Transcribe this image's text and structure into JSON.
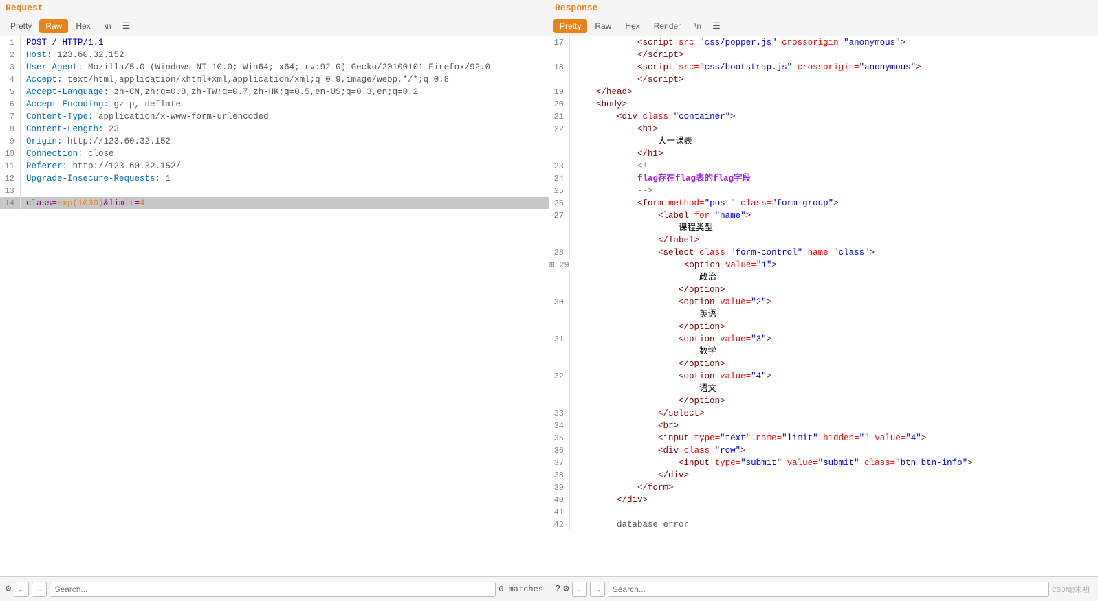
{
  "request": {
    "header": "Request",
    "tabs": [
      "Pretty",
      "Raw",
      "Hex",
      "\\n",
      "☰"
    ],
    "active_tab": "Raw",
    "lines": [
      {
        "num": 1,
        "content": "POST / HTTP/1.1",
        "type": "method"
      },
      {
        "num": 2,
        "content": "Host: 123.60.32.152",
        "type": "header"
      },
      {
        "num": 3,
        "content": "User-Agent: Mozilla/5.0 (Windows NT 10.0; Win64; x64; rv:92.0) Gecko/20100101 Firefox/92.0",
        "type": "header"
      },
      {
        "num": 4,
        "content": "Accept: text/html,application/xhtml+xml,application/xml;q=0.9,image/webp,*/*;q=0.8",
        "type": "header"
      },
      {
        "num": 5,
        "content": "Accept-Language: zh-CN,zh;q=0.8,zh-TW;q=0.7,zh-HK;q=0.5,en-US;q=0.3,en;q=0.2",
        "type": "header"
      },
      {
        "num": 6,
        "content": "Accept-Encoding: gzip, deflate",
        "type": "header"
      },
      {
        "num": 7,
        "content": "Content-Type: application/x-www-form-urlencoded",
        "type": "header"
      },
      {
        "num": 8,
        "content": "Content-Length: 23",
        "type": "header"
      },
      {
        "num": 9,
        "content": "Origin: http://123.60.32.152",
        "type": "header"
      },
      {
        "num": 10,
        "content": "Connection: close",
        "type": "header"
      },
      {
        "num": 11,
        "content": "Referer: http://123.60.32.152/",
        "type": "header"
      },
      {
        "num": 12,
        "content": "Upgrade-Insecure-Requests: 1",
        "type": "header"
      },
      {
        "num": 13,
        "content": "",
        "type": "empty"
      },
      {
        "num": 14,
        "content": "class=exp(1000)&limit=4",
        "type": "body",
        "highlighted": true
      }
    ]
  },
  "response": {
    "header": "Response",
    "tabs": [
      "Pretty",
      "Raw",
      "Hex",
      "Render",
      "\\n",
      "☰"
    ],
    "active_tab": "Pretty",
    "lines": [
      {
        "num": 17,
        "html": "<span class='res-tag'>&lt;script</span> <span class='res-attr-name'>src=</span><span class='res-attr-value'>\"css/popper.js\"</span> <span class='res-attr-name'>crossorigin=</span><span class='res-attr-value'>\"anonymous\"</span><span class='res-tag'>&gt;</span>",
        "indent": 12
      },
      {
        "num": null,
        "html": "<span class='res-tag'>&lt;/script&gt;</span>",
        "indent": 12
      },
      {
        "num": 18,
        "html": "<span class='res-tag'>&lt;script</span> <span class='res-attr-name'>src=</span><span class='res-attr-value'>\"css/bootstrap.js\"</span> <span class='res-attr-name'>crossorigin=</span><span class='res-attr-value'>\"anonymous\"</span><span class='res-tag'>&gt;</span>",
        "indent": 12
      },
      {
        "num": null,
        "html": "<span class='res-tag'>&lt;/script&gt;</span>",
        "indent": 12
      },
      {
        "num": 19,
        "html": "<span class='res-tag'>&lt;/head&gt;</span>",
        "indent": 4
      },
      {
        "num": 20,
        "html": "<span class='res-tag'>&lt;body&gt;</span>",
        "indent": 4
      },
      {
        "num": 21,
        "html": "<span class='res-tag'>&lt;div</span> <span class='res-attr-name'>class=</span><span class='res-attr-value'>\"container\"</span><span class='res-tag'>&gt;</span>",
        "indent": 8
      },
      {
        "num": 22,
        "html": "<span class='res-tag'>&lt;h1&gt;</span>",
        "indent": 12
      },
      {
        "num": null,
        "html": "<span class='res-text'>大一课表</span>",
        "indent": 16
      },
      {
        "num": null,
        "html": "<span class='res-tag'>&lt;/h1&gt;</span>",
        "indent": 12
      },
      {
        "num": 23,
        "html": "<span class='res-comment'>&lt;!--</span>",
        "indent": 12
      },
      {
        "num": 24,
        "html": "<span class='res-highlight-text'>flag存在flag表的flag字段</span>",
        "indent": 12
      },
      {
        "num": 25,
        "html": "<span class='res-comment'>--&gt;</span>",
        "indent": 12
      },
      {
        "num": 26,
        "html": "<span class='res-tag'>&lt;form</span> <span class='res-attr-name'>method=</span><span class='res-attr-value'>\"post\"</span> <span class='res-attr-name'>class=</span><span class='res-attr-value'>\"form-group\"</span><span class='res-tag'>&gt;</span>",
        "indent": 12
      },
      {
        "num": 27,
        "html": "<span class='res-tag'>&lt;label</span> <span class='res-attr-name'>for=</span><span class='res-attr-value'>\"name\"</span><span class='res-tag'>&gt;</span>",
        "indent": 16
      },
      {
        "num": null,
        "html": "<span class='res-text'>课程类型</span>",
        "indent": 20
      },
      {
        "num": null,
        "html": "<span class='res-tag'>&lt;/label&gt;</span>",
        "indent": 16
      },
      {
        "num": 28,
        "html": "<span class='res-tag'>&lt;select</span> <span class='res-attr-name'>class=</span><span class='res-attr-value'>\"form-control\"</span> <span class='res-attr-name'>name=</span><span class='res-attr-value'>\"class\"</span><span class='res-tag'>&gt;</span>",
        "indent": 16
      },
      {
        "num": 29,
        "html": "<span class='res-tag'>&lt;option</span> <span class='res-attr-name'>value=</span><span class='res-attr-value'>\"1\"</span><span class='res-tag'>&gt;</span>",
        "indent": 20
      },
      {
        "num": null,
        "html": "<span class='res-text'>政治</span>",
        "indent": 24
      },
      {
        "num": null,
        "html": "<span class='res-tag'>&lt;/option&gt;</span>",
        "indent": 20
      },
      {
        "num": 30,
        "html": "<span class='res-tag'>&lt;option</span> <span class='res-attr-name'>value=</span><span class='res-attr-value'>\"2\"</span><span class='res-tag'>&gt;</span>",
        "indent": 20
      },
      {
        "num": null,
        "html": "<span class='res-text'>英语</span>",
        "indent": 24
      },
      {
        "num": null,
        "html": "<span class='res-tag'>&lt;/option&gt;</span>",
        "indent": 20
      },
      {
        "num": 31,
        "html": "<span class='res-tag'>&lt;option</span> <span class='res-attr-name'>value=</span><span class='res-attr-value'>\"3\"</span><span class='res-tag'>&gt;</span>",
        "indent": 20
      },
      {
        "num": null,
        "html": "<span class='res-text'>数学</span>",
        "indent": 24
      },
      {
        "num": null,
        "html": "<span class='res-tag'>&lt;/option&gt;</span>",
        "indent": 20
      },
      {
        "num": 32,
        "html": "<span class='res-tag'>&lt;option</span> <span class='res-attr-name'>value=</span><span class='res-attr-value'>\"4\"</span><span class='res-tag'>&gt;</span>",
        "indent": 20
      },
      {
        "num": null,
        "html": "<span class='res-text'>语文</span>",
        "indent": 24
      },
      {
        "num": null,
        "html": "<span class='res-tag'>&lt;/option&gt;</span>",
        "indent": 20
      },
      {
        "num": 33,
        "html": "<span class='res-tag'>&lt;/select&gt;</span>",
        "indent": 16
      },
      {
        "num": 34,
        "html": "<span class='res-tag'>&lt;br&gt;</span>",
        "indent": 16
      },
      {
        "num": 35,
        "html": "<span class='res-tag'>&lt;input</span> <span class='res-attr-name'>type=</span><span class='res-attr-value'>\"text\"</span> <span class='res-attr-name'>name=</span><span class='res-attr-value'>\"limit\"</span> <span class='res-attr-name'>hidden=</span><span class='res-attr-value'>\"\"</span> <span class='res-attr-name'>value=</span><span class='res-attr-value'>\"4\"</span><span class='res-tag'>&gt;</span>",
        "indent": 16
      },
      {
        "num": 36,
        "html": "<span class='res-tag'>&lt;div</span> <span class='res-attr-name'>class=</span><span class='res-attr-value'>\"row\"</span><span class='res-tag'>&gt;</span>",
        "indent": 16
      },
      {
        "num": 37,
        "html": "<span class='res-tag'>&lt;input</span> <span class='res-attr-name'>type=</span><span class='res-attr-value'>\"submit\"</span> <span class='res-attr-name'>value=</span><span class='res-attr-value'>\"submit\"</span> <span class='res-attr-name'>class=</span><span class='res-attr-value'>\"btn btn-info\"</span><span class='res-tag'>&gt;</span>",
        "indent": 20
      },
      {
        "num": 38,
        "html": "<span class='res-tag'>&lt;/div&gt;</span>",
        "indent": 16
      },
      {
        "num": 39,
        "html": "<span class='res-tag'>&lt;/form&gt;</span>",
        "indent": 12
      },
      {
        "num": 40,
        "html": "<span class='res-tag'>&lt;/div&gt;</span>",
        "indent": 8
      },
      {
        "num": 41,
        "html": "",
        "indent": 0
      },
      {
        "num": 42,
        "html": "<span class='res-error'>database error</span>",
        "indent": 8
      }
    ]
  },
  "bottom_left": {
    "search_placeholder": "Search...",
    "matches_label": "0 matches"
  },
  "bottom_right": {
    "search_placeholder": "Search...",
    "watermark": "CSDN@末初"
  }
}
